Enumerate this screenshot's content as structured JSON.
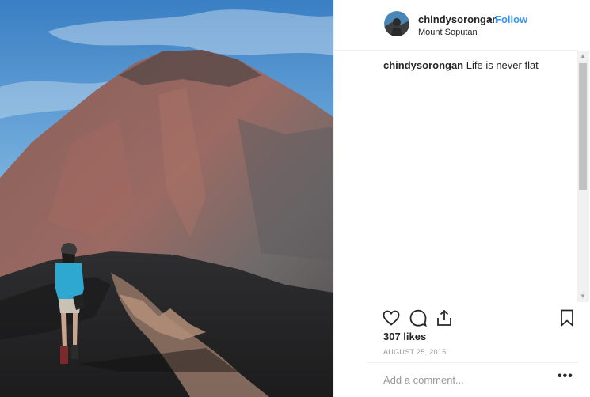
{
  "post": {
    "username": "chindysorongan",
    "separator": "•",
    "follow_label": "Follow",
    "location": "Mount Soputan",
    "caption_user": "chindysorongan",
    "caption_text": "Life is never flat",
    "likes": "307 likes",
    "date": "AUGUST 25, 2015",
    "comment_placeholder": "Add a comment...",
    "more_label": "•••"
  },
  "scrollbar": {
    "up_arrow": "▲",
    "down_arrow": "▼"
  },
  "icons": {
    "like": "heart-icon",
    "comment": "comment-icon",
    "share": "share-icon",
    "save": "bookmark-icon"
  },
  "colors": {
    "accent": "#3897f0",
    "text": "#262626",
    "muted": "#999999",
    "divider": "#efefef"
  }
}
